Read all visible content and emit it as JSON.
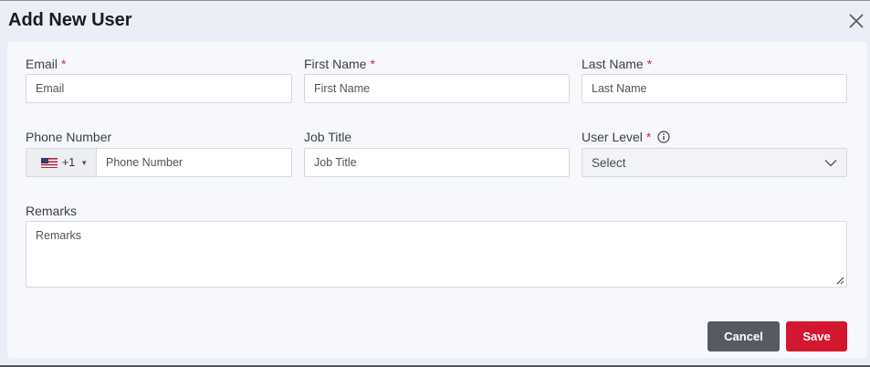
{
  "dialog": {
    "title": "Add New User",
    "close_icon": "close-icon"
  },
  "form": {
    "email": {
      "label": "Email",
      "required": "*",
      "placeholder": "Email"
    },
    "first_name": {
      "label": "First Name",
      "required": "*",
      "placeholder": "First Name"
    },
    "last_name": {
      "label": "Last Name",
      "required": "*",
      "placeholder": "Last Name"
    },
    "phone": {
      "label": "Phone Number",
      "country_flag": "us-flag-icon",
      "country_code": "+1",
      "placeholder": "Phone Number"
    },
    "job_title": {
      "label": "Job Title",
      "placeholder": "Job Title"
    },
    "user_level": {
      "label": "User Level",
      "required": "*",
      "info_icon": "info-icon",
      "selected": "Select",
      "chevron_icon": "chevron-down-icon"
    },
    "remarks": {
      "label": "Remarks",
      "placeholder": "Remarks"
    }
  },
  "actions": {
    "cancel_label": "Cancel",
    "save_label": "Save"
  },
  "colors": {
    "required": "#d8253a",
    "save_button": "#d3172f",
    "cancel_button": "#555a63"
  }
}
